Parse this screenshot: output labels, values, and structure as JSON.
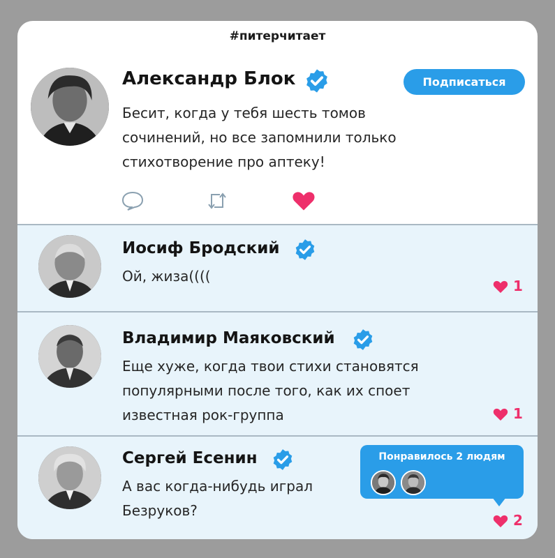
{
  "hashtag": "#питерчитает",
  "main_post": {
    "author": "Александр Блок",
    "verified": true,
    "subscribe_label": "Подписаться",
    "text_lines": [
      "Бесит, когда у тебя шесть томов",
      "сочинений, но все запомнили только",
      "стихотворение про аптеку!"
    ],
    "actions": {
      "reply_icon": "speech-bubble-icon",
      "retweet_icon": "retweet-icon",
      "like_icon": "heart-icon",
      "liked": true
    }
  },
  "replies": [
    {
      "author": "Иосиф Бродский",
      "verified": true,
      "text_lines": [
        "Ой, жиза(((("
      ],
      "likes": "1"
    },
    {
      "author": "Владимир Маяковский",
      "verified": true,
      "text_lines": [
        "Еще хуже, когда твои стихи становятся",
        "популярными после того, как их споет",
        "известная рок-группа"
      ],
      "likes": "1"
    },
    {
      "author": "Сергей Есенин",
      "verified": true,
      "text_lines": [
        "А вас когда-нибудь играл",
        "Безруков?"
      ],
      "likes": "2",
      "liked_by_popup": {
        "label": "Понравилось 2 людям",
        "avatars": 2
      }
    }
  ],
  "colors": {
    "accent_blue": "#2a9de8",
    "like_pink": "#ee2f6b",
    "reply_bg": "#e8f4fb",
    "frame_gray": "#9c9c9c"
  }
}
